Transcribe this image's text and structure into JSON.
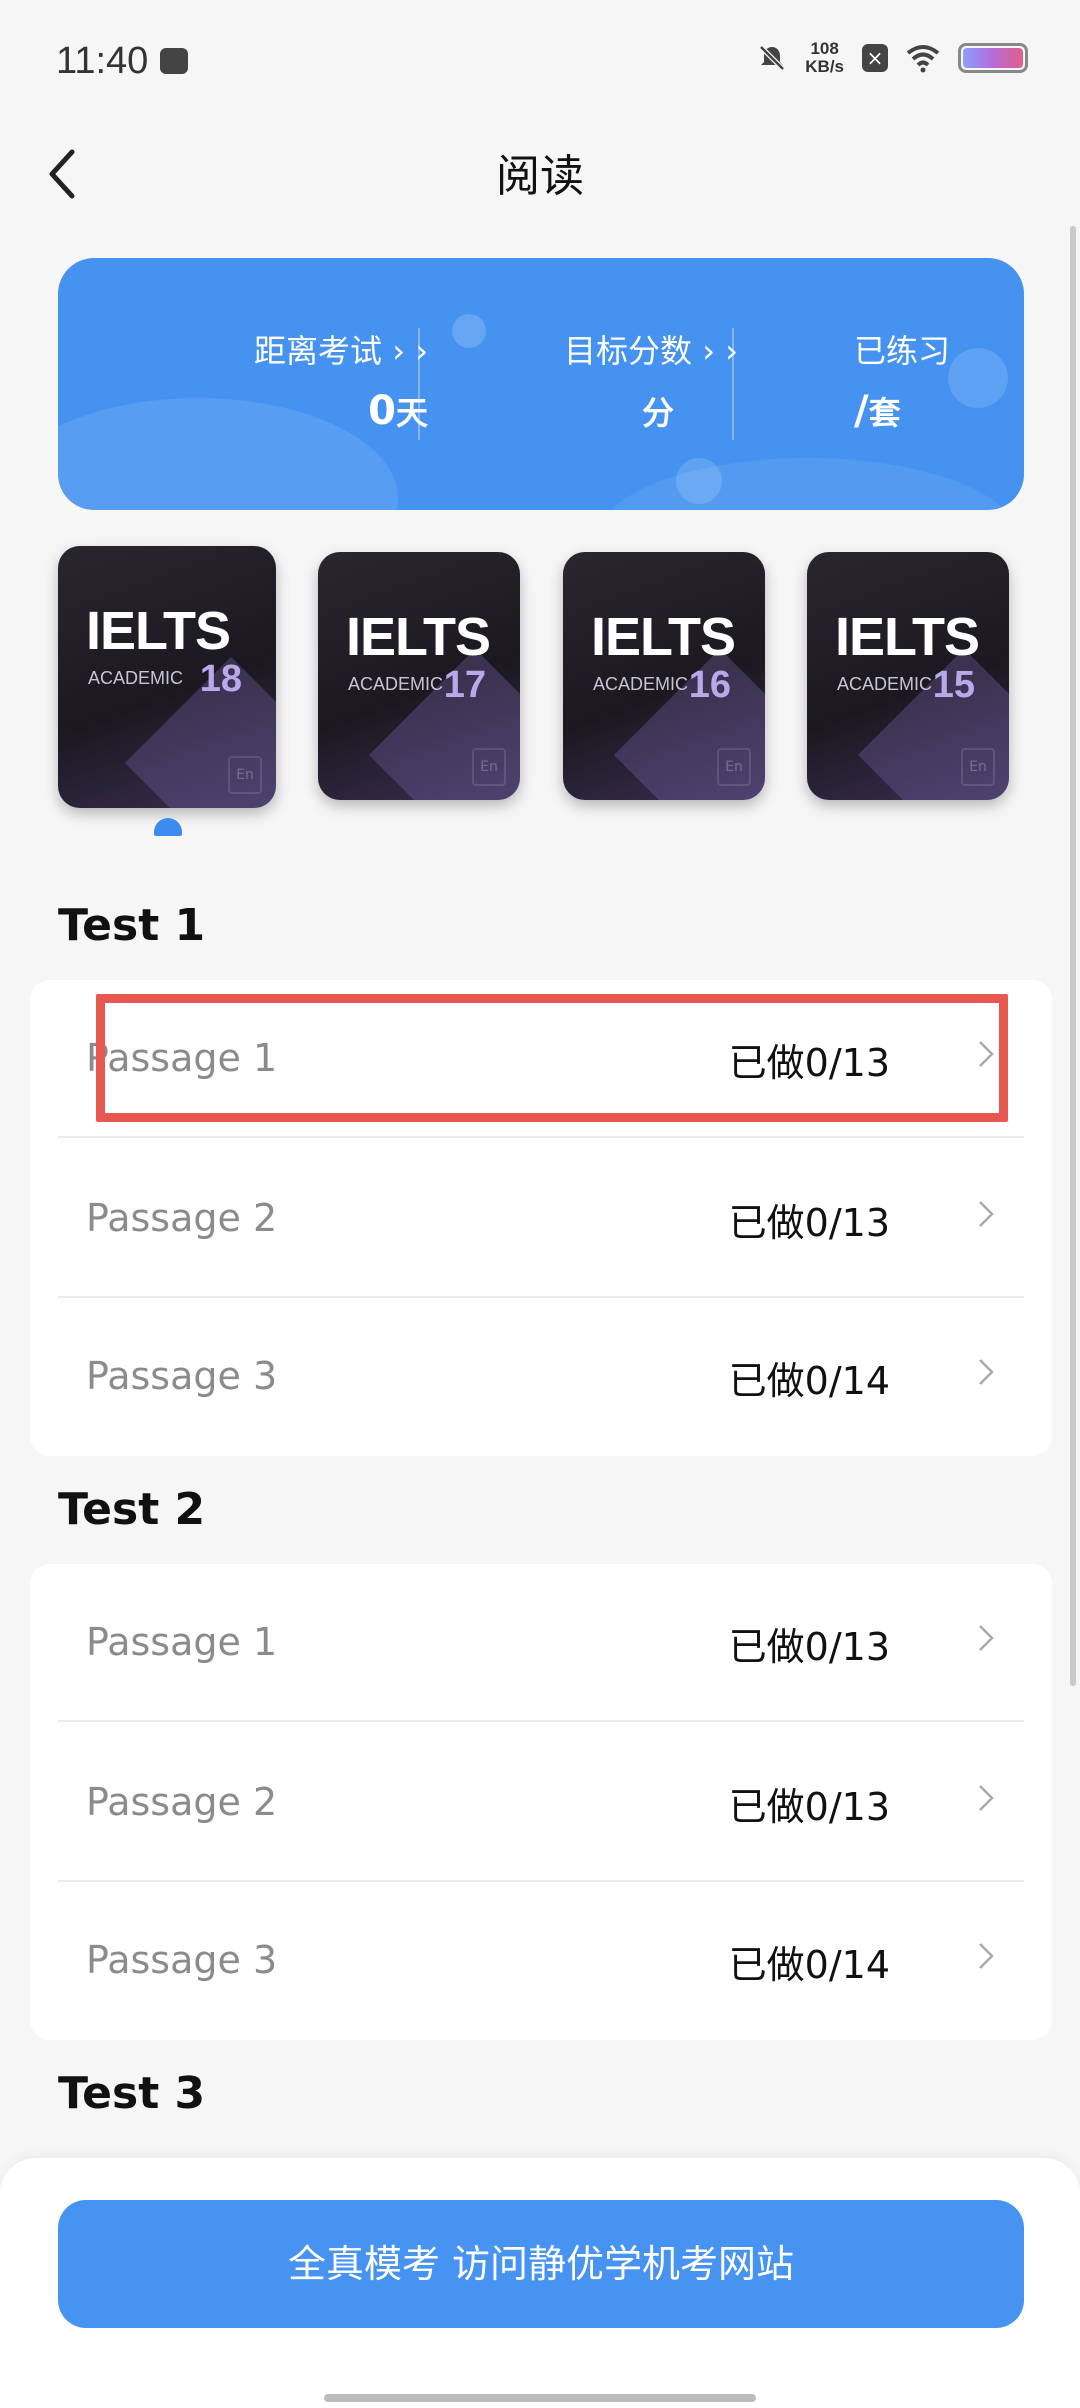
{
  "status_bar": {
    "time": "11:40",
    "speed_value": "108",
    "speed_unit": "KB/s"
  },
  "header": {
    "title": "阅读"
  },
  "banner": {
    "exam_countdown_label": "距离考试",
    "exam_countdown_value": "0",
    "exam_countdown_unit": "天",
    "target_score_label": "目标分数",
    "target_score_value": "",
    "target_score_unit": "分",
    "practiced_label": "已练习",
    "practiced_value": "/",
    "practiced_unit": "套",
    "arrows": "› ›"
  },
  "books": [
    {
      "brand": "IELTS",
      "series": "ACADEMIC",
      "number": "18",
      "tag": "En",
      "selected": true
    },
    {
      "brand": "IELTS",
      "series": "ACADEMIC",
      "number": "17",
      "tag": "En",
      "selected": false
    },
    {
      "brand": "IELTS",
      "series": "ACADEMIC",
      "number": "16",
      "tag": "En",
      "selected": false
    },
    {
      "brand": "IELTS",
      "series": "ACADEMIC",
      "number": "15",
      "tag": "En",
      "selected": false
    }
  ],
  "tests": [
    {
      "title": "Test 1",
      "passages": [
        {
          "name": "Passage 1",
          "progress": "已做0/13"
        },
        {
          "name": "Passage 2",
          "progress": "已做0/13"
        },
        {
          "name": "Passage 3",
          "progress": "已做0/14"
        }
      ]
    },
    {
      "title": "Test 2",
      "passages": [
        {
          "name": "Passage 1",
          "progress": "已做0/13"
        },
        {
          "name": "Passage 2",
          "progress": "已做0/13"
        },
        {
          "name": "Passage 3",
          "progress": "已做0/14"
        }
      ]
    },
    {
      "title": "Test 3",
      "passages": []
    }
  ],
  "cta": {
    "label": "全真模考 访问静优学机考网站"
  },
  "colors": {
    "accent": "#4592f0",
    "highlight": "#e85650"
  }
}
